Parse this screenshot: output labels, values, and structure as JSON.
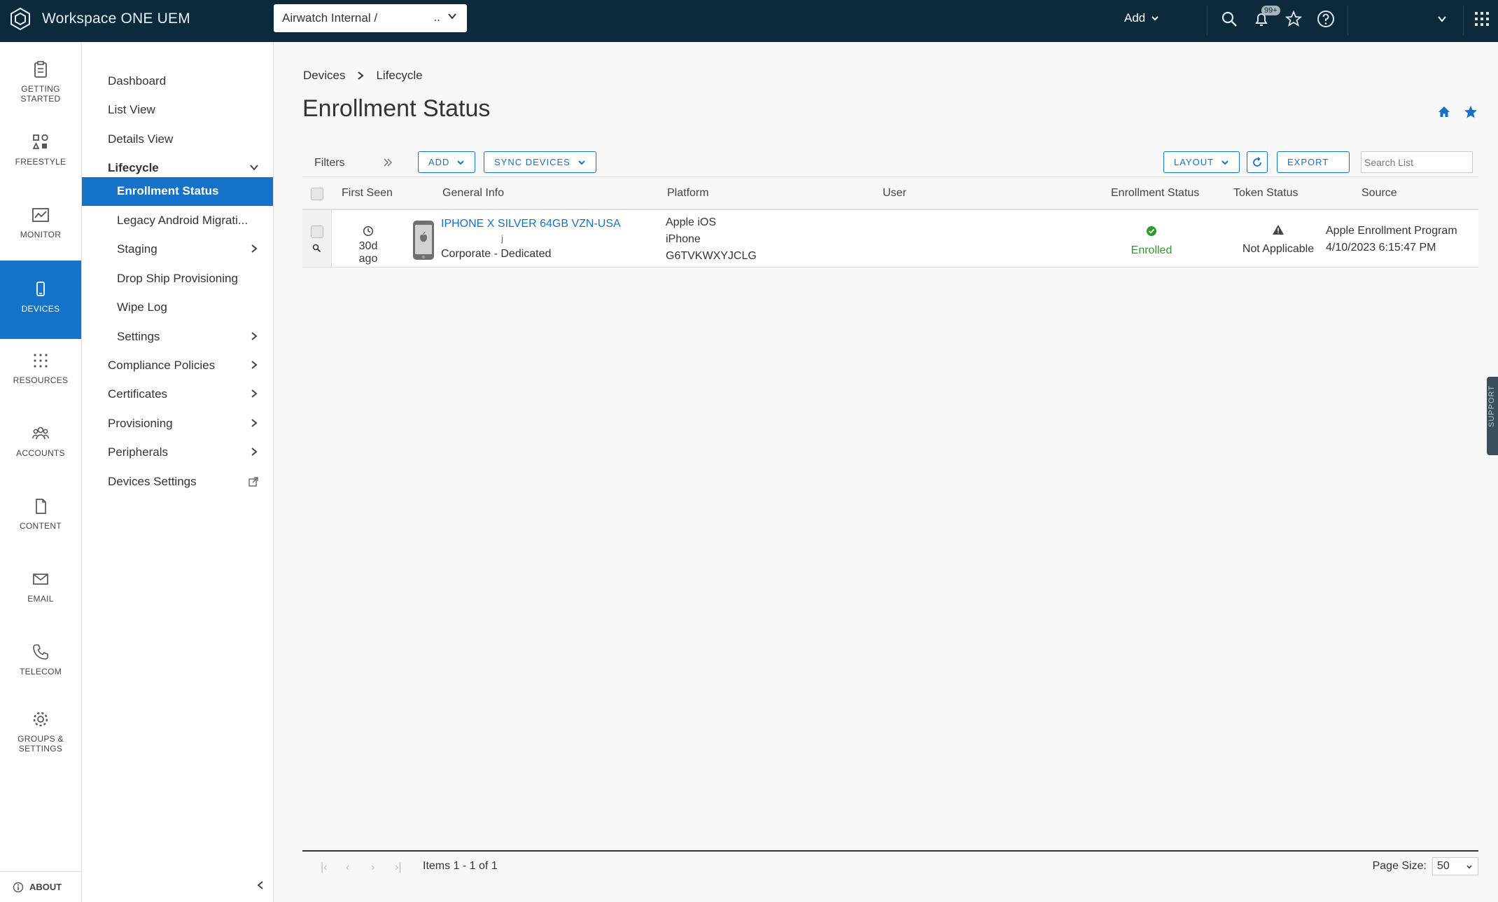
{
  "header": {
    "app_title": "Workspace ONE UEM",
    "org_name": "Airwatch Internal /",
    "org_suffix": "..",
    "add_label": "Add",
    "notification_count": "99+"
  },
  "rail": [
    {
      "label1": "GETTING",
      "label2": "STARTED",
      "icon": "clipboard-icon"
    },
    {
      "label1": "FREESTYLE",
      "label2": "",
      "icon": "freestyle-icon"
    },
    {
      "label1": "MONITOR",
      "label2": "",
      "icon": "monitor-chart-icon"
    },
    {
      "label1": "DEVICES",
      "label2": "",
      "icon": "phone-icon"
    },
    {
      "label1": "RESOURCES",
      "label2": "",
      "icon": "grid-dots-icon"
    },
    {
      "label1": "ACCOUNTS",
      "label2": "",
      "icon": "users-icon"
    },
    {
      "label1": "CONTENT",
      "label2": "",
      "icon": "document-icon"
    },
    {
      "label1": "EMAIL",
      "label2": "",
      "icon": "envelope-icon"
    },
    {
      "label1": "TELECOM",
      "label2": "",
      "icon": "telephone-icon"
    },
    {
      "label1": "GROUPS &",
      "label2": "SETTINGS",
      "icon": "gear-icon"
    }
  ],
  "about_label": "ABOUT",
  "subnav": {
    "dashboard": "Dashboard",
    "list_view": "List View",
    "details_view": "Details View",
    "lifecycle": "Lifecycle",
    "enrollment_status": "Enrollment Status",
    "legacy_android": "Legacy Android Migrati...",
    "staging": "Staging",
    "drop_ship": "Drop Ship Provisioning",
    "wipe_log": "Wipe Log",
    "settings": "Settings",
    "compliance": "Compliance Policies",
    "certificates": "Certificates",
    "provisioning": "Provisioning",
    "peripherals": "Peripherals",
    "devices_settings": "Devices Settings"
  },
  "breadcrumb": [
    "Devices",
    "Lifecycle"
  ],
  "page_title": "Enrollment Status",
  "toolbar": {
    "filters": "Filters",
    "add": "ADD",
    "sync": "SYNC DEVICES",
    "layout": "LAYOUT",
    "export": "EXPORT",
    "search_placeholder": "Search List"
  },
  "columns": [
    "First Seen",
    "General Info",
    "Platform",
    "User",
    "Enrollment Status",
    "Token Status",
    "Source"
  ],
  "row": {
    "first_seen": "30d ago",
    "device_name": "IPHONE X SILVER 64GB VZN-USA",
    "device_sub": "j",
    "ownership": "Corporate - Dedicated",
    "platform": "Apple iOS",
    "model": "iPhone",
    "serial": "G6TVKWXYJCLG",
    "enrollment_status": "Enrolled",
    "token_status": "Not Applicable",
    "source": "Apple Enrollment Program",
    "source_date": "4/10/2023 6:15:47 PM"
  },
  "pager": {
    "items": "Items 1 - 1 of 1",
    "page_size_label": "Page Size:",
    "page_size": "50"
  },
  "support_label": "SUPPORT",
  "colors": {
    "topbar": "#0b2a3c",
    "accent": "#1572c9",
    "ok": "#2b9d2b"
  }
}
